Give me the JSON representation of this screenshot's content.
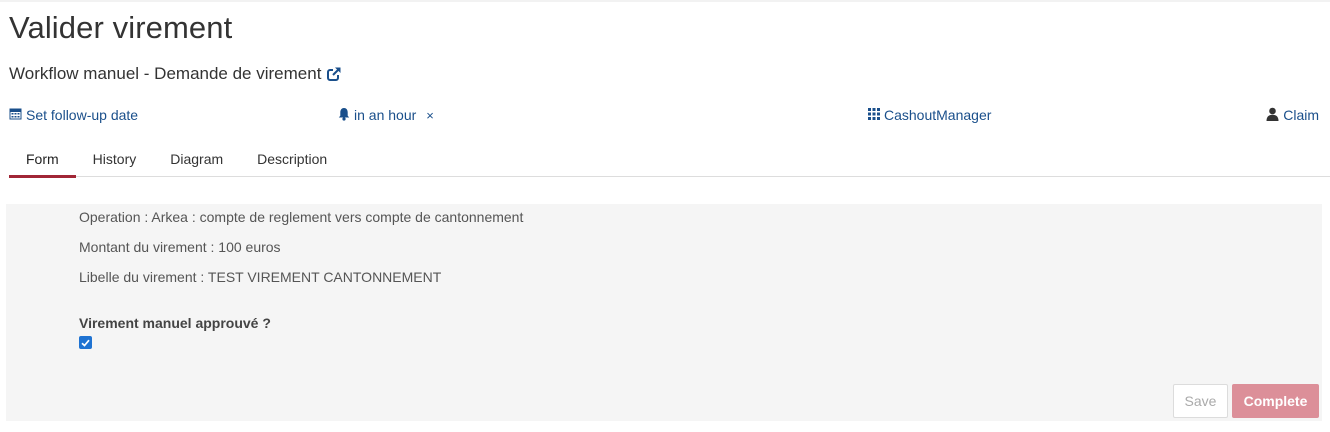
{
  "header": {
    "title": "Valider virement",
    "process_name": "Workflow manuel - Demande de virement"
  },
  "actions": {
    "follow_up_label": "Set follow-up date",
    "reminder_label": "in an hour",
    "reminder_remove": "×",
    "group_label": "CashoutManager",
    "claim_label": "Claim"
  },
  "tabs": [
    {
      "label": "Form",
      "active": true
    },
    {
      "label": "History",
      "active": false
    },
    {
      "label": "Diagram",
      "active": false
    },
    {
      "label": "Description",
      "active": false
    }
  ],
  "form": {
    "lines": [
      "Operation : Arkea : compte de reglement vers compte de cantonnement",
      "Montant du virement : 100 euros",
      "Libelle du virement : TEST VIREMENT CANTONNEMENT"
    ],
    "checkbox_label": "Virement manuel approuvé ?",
    "checkbox_checked": true,
    "save_label": "Save",
    "complete_label": "Complete"
  },
  "colors": {
    "link": "#1a4f8b",
    "active_tab_underline": "#a12636",
    "complete_button": "#dc8f99",
    "checkbox": "#1f73d2"
  }
}
